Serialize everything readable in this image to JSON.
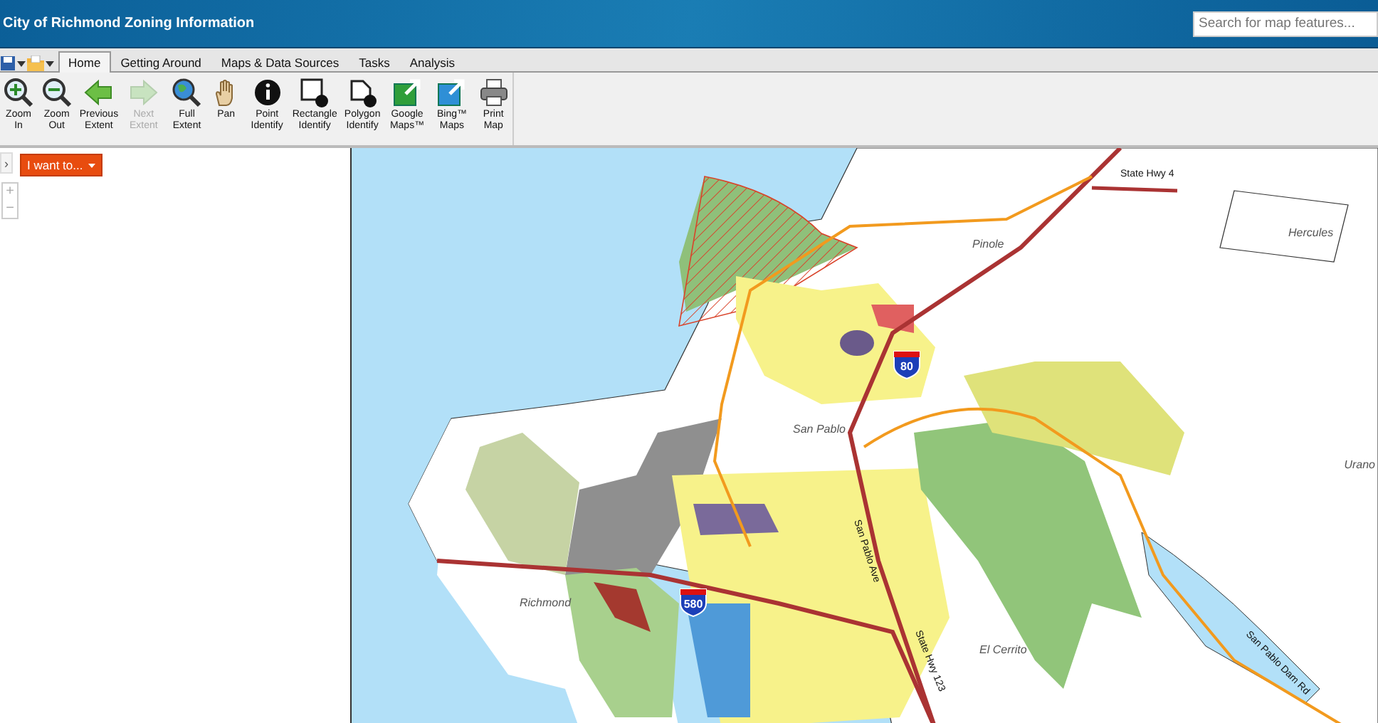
{
  "app": {
    "title": "City of Richmond Zoning Information",
    "search": {
      "placeholder": "Search for map features..."
    }
  },
  "tabs": [
    {
      "label": "Home",
      "selected": true
    },
    {
      "label": "Getting Around",
      "selected": false
    },
    {
      "label": "Maps & Data Sources",
      "selected": false
    },
    {
      "label": "Tasks",
      "selected": false
    },
    {
      "label": "Analysis",
      "selected": false
    }
  ],
  "tools": [
    {
      "label": "Zoom In",
      "kind": "zoom-in",
      "disabled": false
    },
    {
      "label": "Zoom Out",
      "kind": "zoom-out",
      "disabled": false
    },
    {
      "label": "Previous Extent",
      "kind": "back",
      "disabled": false
    },
    {
      "label": "Next Extent",
      "kind": "forward",
      "disabled": true
    },
    {
      "label": "Full Extent",
      "kind": "globe",
      "disabled": false
    },
    {
      "label": "Pan",
      "kind": "hand",
      "disabled": false
    },
    {
      "label": "Point Identify",
      "kind": "info",
      "disabled": false
    },
    {
      "label": "Rectangle Identify",
      "kind": "rect",
      "disabled": false
    },
    {
      "label": "Polygon Identify",
      "kind": "poly",
      "disabled": false
    },
    {
      "label": "Google Maps™",
      "kind": "ext-green",
      "disabled": false
    },
    {
      "label": "Bing™ Maps",
      "kind": "ext-blue",
      "disabled": false
    },
    {
      "label": "Print Map",
      "kind": "print",
      "disabled": false
    }
  ],
  "panel": {
    "toggle": "›",
    "menu_button": "I want to...",
    "zoom_in": "+",
    "zoom_out": "−"
  },
  "map": {
    "labels": [
      {
        "text": "State Hwy 4",
        "kind": "road"
      },
      {
        "text": "Pinole",
        "kind": "place"
      },
      {
        "text": "Hercules",
        "kind": "place"
      },
      {
        "text": "San Pablo",
        "kind": "place"
      },
      {
        "text": "Urano",
        "kind": "place"
      },
      {
        "text": "San Pablo Ave",
        "kind": "road"
      },
      {
        "text": "Richmond",
        "kind": "place"
      },
      {
        "text": "El Cerrito",
        "kind": "place"
      },
      {
        "text": "State Hwy 123",
        "kind": "road"
      },
      {
        "text": "San Pablo Dam Rd",
        "kind": "road"
      }
    ],
    "shields": [
      {
        "text": "80"
      },
      {
        "text": "580"
      }
    ]
  }
}
